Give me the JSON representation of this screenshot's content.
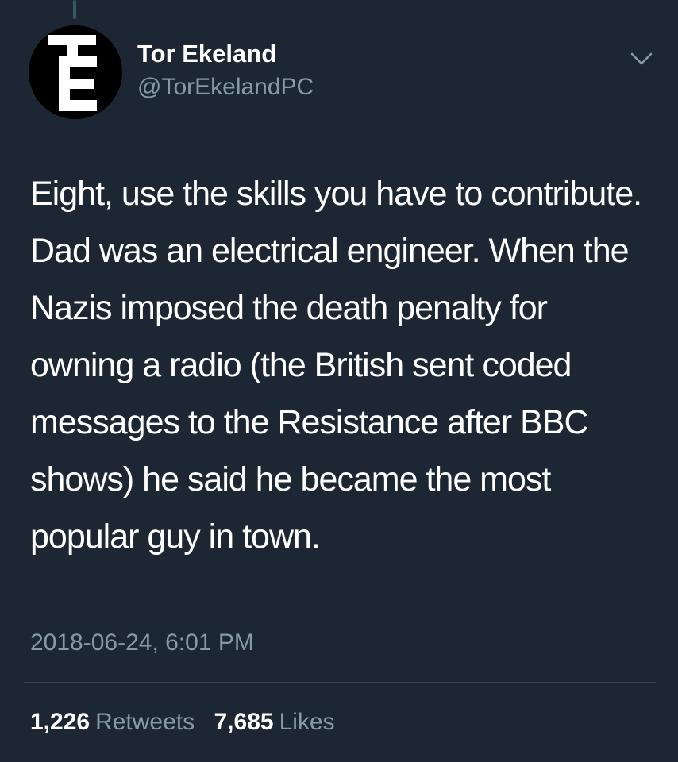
{
  "tweet": {
    "author": {
      "display_name": "Tor Ekeland",
      "handle": "@TorEkelandPC",
      "avatar_letters": "TE"
    },
    "text": "Eight, use the skills you have to contribute. Dad was an electrical engineer. When the Nazis imposed the death penalty for owning a radio (the British sent coded messages to the Resistance after BBC shows) he said he became the most popular guy in town.",
    "timestamp": "2018-06-24, 6:01 PM",
    "stats": {
      "retweets_count": "1,226",
      "retweets_label": "Retweets",
      "likes_count": "7,685",
      "likes_label": "Likes"
    }
  },
  "icons": {
    "menu": "chevron-down-icon"
  },
  "colors": {
    "background": "#1c2733",
    "primary_text": "#ffffff",
    "secondary_text": "#8899a6",
    "divider": "#38444d",
    "avatar_bg": "#000000"
  }
}
